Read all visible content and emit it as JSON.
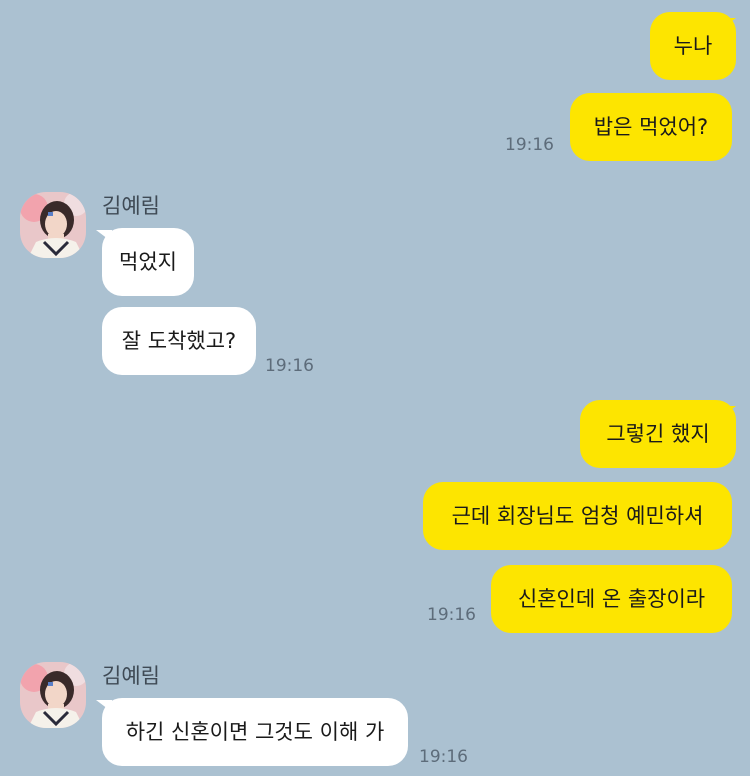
{
  "contact": {
    "name": "김예림",
    "avatar_icon": "profile-photo"
  },
  "messages": [
    {
      "sender": "me",
      "text": "누나"
    },
    {
      "sender": "me",
      "text": "밥은 먹었어?",
      "time": "19:16"
    },
    {
      "sender": "them",
      "text": "먹었지"
    },
    {
      "sender": "them",
      "text": "잘 도착했고?",
      "time": "19:16"
    },
    {
      "sender": "me",
      "text": "그렇긴 했지"
    },
    {
      "sender": "me",
      "text": "근데 회장님도 엄청 예민하셔"
    },
    {
      "sender": "me",
      "text": "신혼인데 온 출장이라",
      "time": "19:16"
    },
    {
      "sender": "them",
      "text": "하긴 신혼이면 그것도 이해 가",
      "time": "19:16"
    }
  ],
  "colors": {
    "background": "#abc1d1",
    "my_bubble": "#fde500",
    "their_bubble": "#ffffff"
  }
}
